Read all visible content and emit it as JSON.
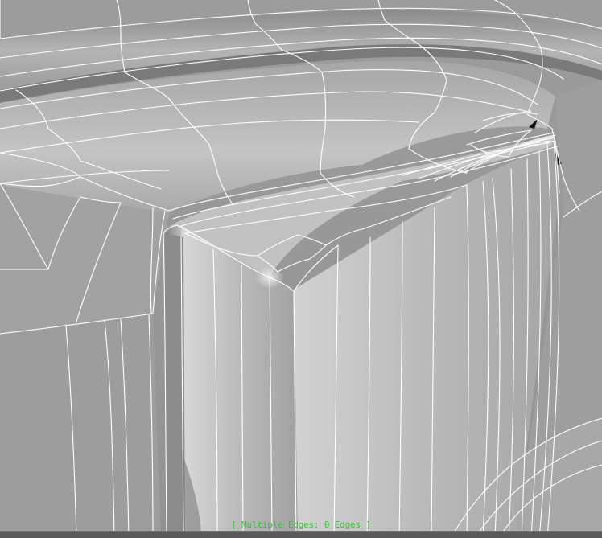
{
  "viewport": {
    "background_color": "#9a9a9a",
    "wire_color": "#ffffff",
    "status_color": "#2ec82e"
  },
  "status": {
    "selection_text": "[ Multiple Edges: 0 Edges ]"
  }
}
